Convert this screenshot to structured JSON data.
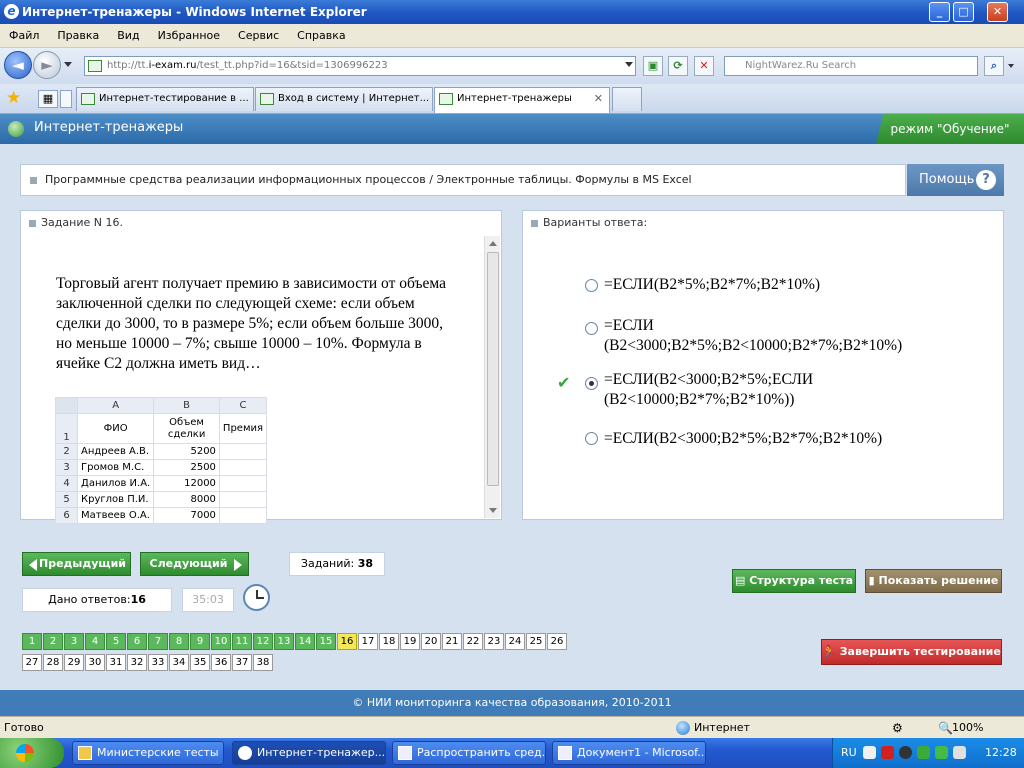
{
  "window": {
    "title": "Интернет-тренажеры - Windows Internet Explorer"
  },
  "menu": [
    "Файл",
    "Правка",
    "Вид",
    "Избранное",
    "Сервис",
    "Справка"
  ],
  "address": {
    "prefix": "http://tt.",
    "domain": "i-exam.ru",
    "path": "/test_tt.php?id=16&tsid=1306996223"
  },
  "search_placeholder": "NightWarez.Ru Search",
  "tabs": [
    {
      "label": "Интернет-тестирование в ..."
    },
    {
      "label": "Вход в систему | Интернет..."
    },
    {
      "label": "Интернет-тренажеры"
    }
  ],
  "app": {
    "title": "Интернет-тренажеры",
    "mode": "режим \"Обучение\""
  },
  "breadcrumb": "Программные средства реализации информационных процессов / Электронные таблицы. Формулы в MS Excel",
  "help_label": "Помощь",
  "task": {
    "header": "Задание N 16.",
    "text": "Торговый агент получает премию в зависимости от объема заключенной сделки по следующей схеме: если объем сделки до 3000, то в размере 5%; если объем больше 3000, но меньше 10000 – 7%; свыше 10000 – 10%. Формула в ячейке С2 должна иметь вид…"
  },
  "sheet": {
    "cols": [
      "A",
      "B",
      "C"
    ],
    "header": {
      "row": "1",
      "a": "ФИО",
      "b": "Объем сделки",
      "c": "Премия"
    },
    "rows": [
      {
        "n": "2",
        "name": "Андреев А.В.",
        "val": "5200"
      },
      {
        "n": "3",
        "name": "Громов М.С.",
        "val": "2500"
      },
      {
        "n": "4",
        "name": "Данилов И.А.",
        "val": "12000"
      },
      {
        "n": "5",
        "name": "Круглов П.И.",
        "val": "8000"
      },
      {
        "n": "6",
        "name": "Матвеев О.А.",
        "val": "7000"
      }
    ]
  },
  "answers": {
    "header": "Варианты ответа:",
    "options": [
      {
        "line1": "=ЕСЛИ(B2*5%;B2*7%;B2*10%)",
        "line2": "",
        "selected": false
      },
      {
        "line1": "=ЕСЛИ",
        "line2": "(B2<3000;B2*5%;B2<10000;B2*7%;B2*10%)",
        "selected": false
      },
      {
        "line1": "=ЕСЛИ(B2<3000;B2*5%;ЕСЛИ",
        "line2": "(B2<10000;B2*7%;B2*10%))",
        "selected": true
      },
      {
        "line1": "=ЕСЛИ(B2<3000;B2*5%;B2*7%;B2*10%)",
        "line2": "",
        "selected": false
      }
    ]
  },
  "nav": {
    "prev": "Предыдущий",
    "next": "Следующий",
    "tasks_label": "Заданий:",
    "tasks_count": "38",
    "answered_label": "Дано ответов:",
    "answered_count": "16",
    "timer": "35:03"
  },
  "actions": {
    "structure": "Структура теста",
    "solution": "Показать решение",
    "finish": "Завершить тестирование"
  },
  "questions": {
    "total": 38,
    "answered_through": 15,
    "current": 16
  },
  "footer": "© НИИ мониторинга качества образования, 2010-2011",
  "status": {
    "left": "Готово",
    "zone": "Интернет",
    "zoom": "100%"
  },
  "taskbar": {
    "items": [
      "Министерские тесты ...",
      "Интернет-тренажер...",
      "Распространить сред...",
      "Документ1 - Microsof..."
    ],
    "lang": "RU",
    "time": "12:28"
  }
}
